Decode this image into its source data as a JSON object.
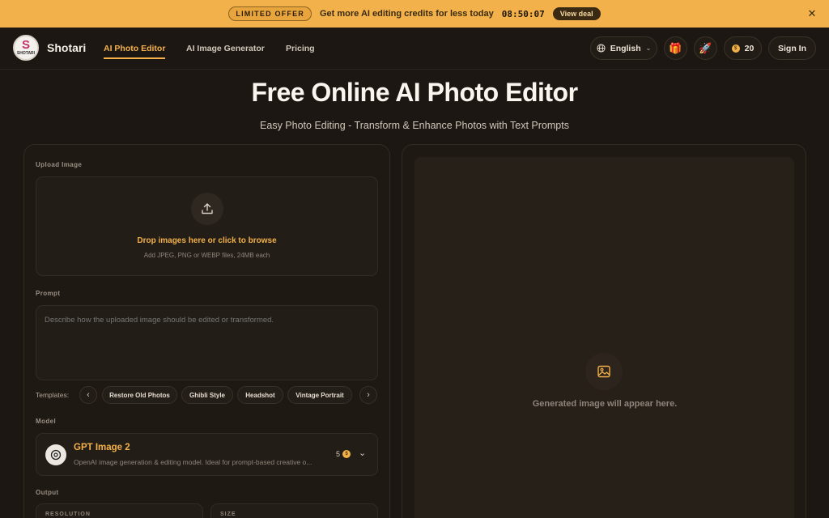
{
  "promo": {
    "badge": "LIMITED OFFER",
    "text": "Get more AI editing credits for less today",
    "timer": "08:50:07",
    "cta": "View deal"
  },
  "nav": {
    "brand": "Shotari",
    "logo_text": "SHOTARI",
    "links": [
      "AI Photo Editor",
      "AI Image Generator",
      "Pricing"
    ],
    "active_link": "AI Photo Editor",
    "language": "English",
    "credits": "20",
    "sign_in": "Sign In"
  },
  "hero": {
    "title": "Free Online AI Photo Editor",
    "subtitle": "Easy Photo Editing - Transform & Enhance Photos with Text Prompts"
  },
  "editor": {
    "upload_label": "Upload Image",
    "upload_main": "Drop images here or click to browse",
    "upload_sub": "Add JPEG, PNG or WEBP files, 24MB each",
    "prompt_label": "Prompt",
    "prompt_placeholder": "Describe how the uploaded image should be edited or transformed.",
    "templates_label": "Templates:",
    "templates": [
      "Restore Old Photos",
      "Ghibli Style",
      "Headshot",
      "Vintage Portrait"
    ],
    "model_label": "Model",
    "model_name": "GPT Image 2",
    "model_desc": "OpenAI image generation & editing model. Ideal for prompt-based creative o...",
    "model_cost": "5",
    "output_label": "Output",
    "resolution_label": "RESOLUTION",
    "size_label": "SIZE"
  },
  "preview": {
    "placeholder": "Generated image will appear here."
  },
  "colors": {
    "accent": "#f2b14a",
    "background": "#1c1712",
    "banner": "#f2b14a"
  }
}
